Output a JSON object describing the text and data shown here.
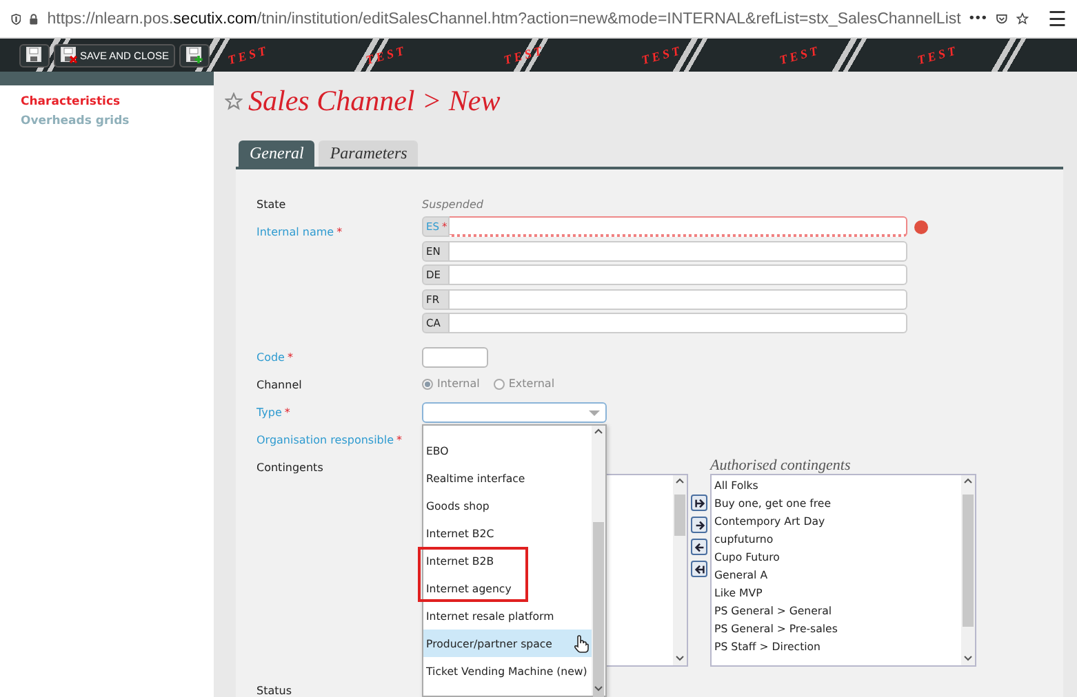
{
  "browser": {
    "url": "https://nlearn.pos.**secutix.com**/tnin/institution/editSalesChannel.htm?action=new&mode=INTERNAL&refList=stx_SalesChannelList",
    "more": "•••",
    "menu": "☰"
  },
  "toolbar": {
    "buttons": [
      {
        "kind": "save"
      },
      {
        "kind": "save-close",
        "label": "SAVE AND CLOSE"
      },
      {
        "kind": "save-new"
      }
    ],
    "environment_banner": [
      "TEST",
      "TEST",
      "TEST",
      "TEST",
      "TEST",
      "TEST"
    ]
  },
  "sidebar": {
    "items": [
      {
        "label": "Characteristics",
        "selected": true
      },
      {
        "label": "Overheads grids",
        "selected": false
      }
    ]
  },
  "page_title": "Sales Channel > New",
  "tabs": [
    {
      "label": "General",
      "selected": true
    },
    {
      "label": "Parameters",
      "selected": false
    }
  ],
  "form": {
    "required_mark": "*",
    "state": {
      "label": "State",
      "value": "Suspended",
      "required": false
    },
    "internal_name": {
      "label": "Internal name",
      "required": true,
      "error": true,
      "languages": [
        {
          "code": "ES",
          "required": true,
          "error": true
        },
        {
          "code": "EN",
          "required": false,
          "error": false
        },
        {
          "code": "DE",
          "required": false,
          "error": false
        },
        {
          "code": "FR",
          "required": false,
          "error": false
        },
        {
          "code": "CA",
          "required": false,
          "error": false
        }
      ]
    },
    "code": {
      "label": "Code",
      "required": true
    },
    "channel": {
      "label": "Channel",
      "required": false,
      "options": [
        {
          "label": "Internal",
          "selected": true
        },
        {
          "label": "External",
          "selected": false
        }
      ]
    },
    "type": {
      "label": "Type",
      "required": true,
      "expanded": true,
      "options": [
        {
          "label": "EBO",
          "selected": false,
          "marked": false
        },
        {
          "label": "Realtime interface",
          "selected": false,
          "marked": false
        },
        {
          "label": "Goods shop",
          "selected": false,
          "marked": false
        },
        {
          "label": "Internet B2C",
          "selected": false,
          "marked": false
        },
        {
          "label": "Internet B2B",
          "selected": false,
          "marked": true
        },
        {
          "label": "Internet agency",
          "selected": false,
          "marked": true
        },
        {
          "label": "Internet resale platform",
          "selected": false,
          "marked": false
        },
        {
          "label": "Producer/partner space",
          "selected": true,
          "marked": false
        },
        {
          "label": "Ticket Vending Machine (new)",
          "selected": false,
          "marked": false
        }
      ]
    },
    "organisation": {
      "label": "Organisation responsible",
      "required": true
    },
    "contingents": {
      "label": "Contingents",
      "required": false,
      "authorised_title": "Authorised contingents",
      "transfer_buttons": [
        {
          "kind": "add-all"
        },
        {
          "kind": "add"
        },
        {
          "kind": "remove"
        },
        {
          "kind": "remove-all"
        }
      ],
      "authorised": [
        "All Folks",
        "Buy one, get one free",
        "Contempory Art Day",
        "cupfuturno",
        "Cupo Futuro",
        "General A",
        "Like MVP",
        "PS General > General",
        "PS General > Pre-sales",
        "PS Staff > Direction"
      ]
    },
    "status": {
      "label": "Status",
      "required": false
    }
  }
}
